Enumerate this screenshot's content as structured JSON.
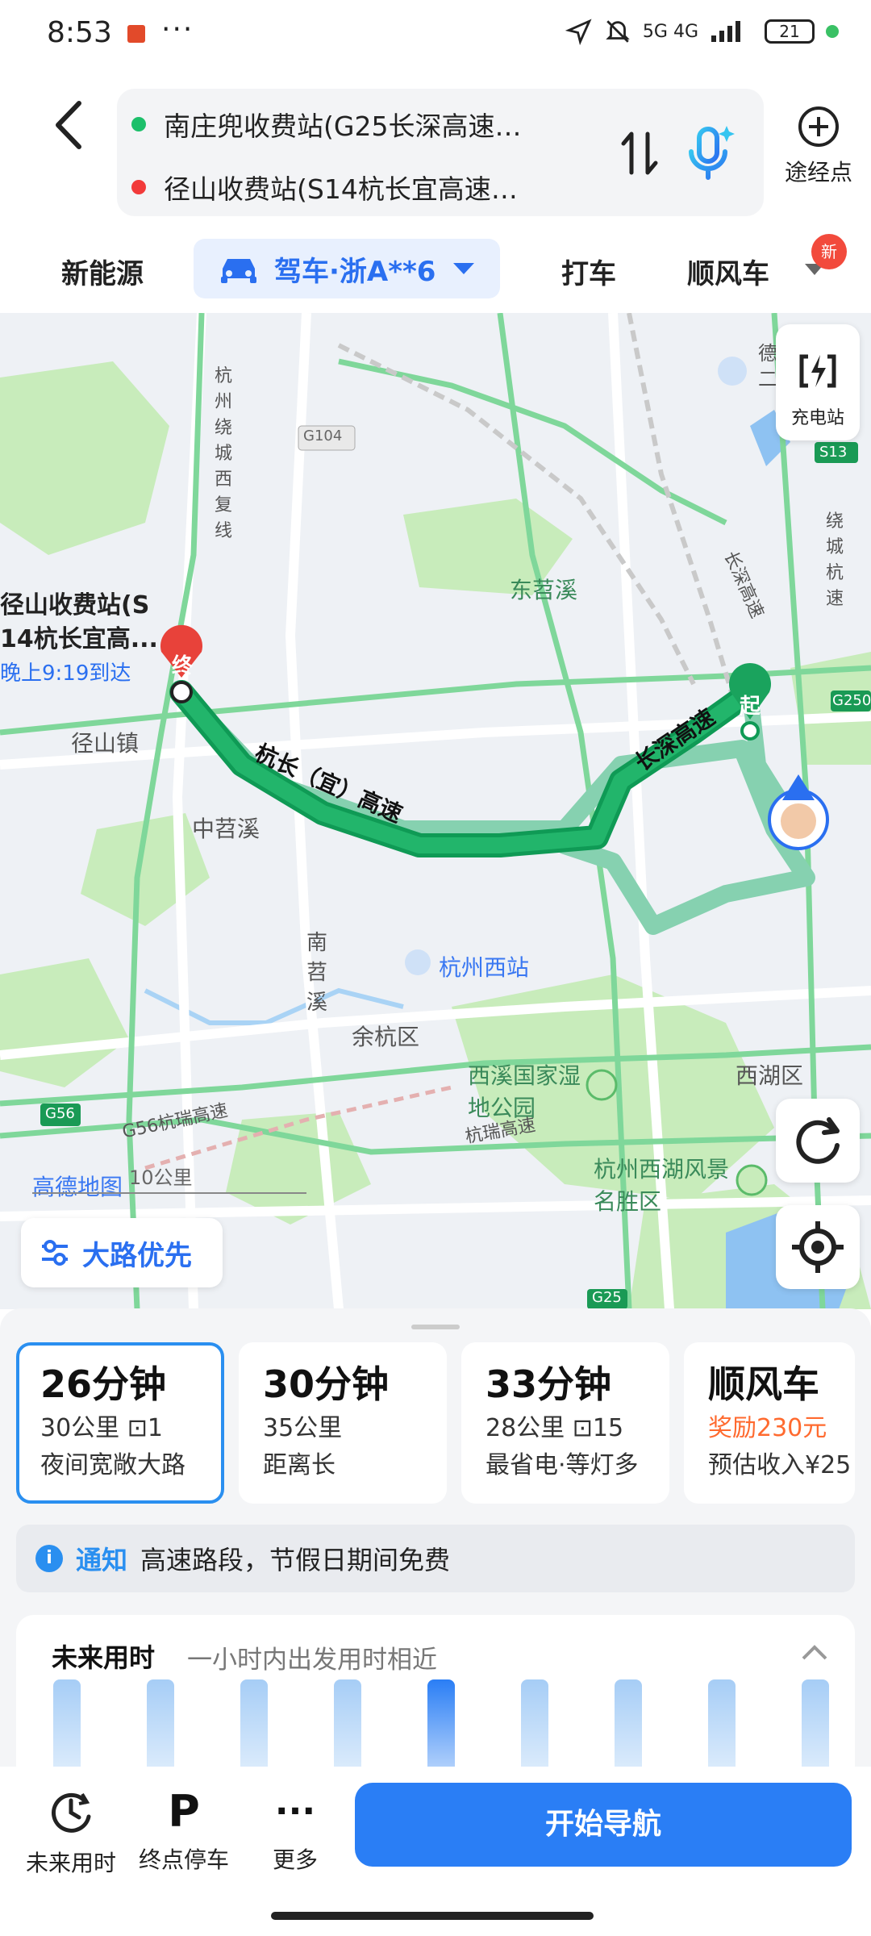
{
  "status_bar": {
    "time": "8:53",
    "dots": "···",
    "network": "5G 4G",
    "battery": "21"
  },
  "header": {
    "origin": "南庄兜收费站(G25长深高速…",
    "destination": "径山收费站(S14杭长宜高速…",
    "waypoint_label": "途经点"
  },
  "tabs": {
    "new_energy": "新能源",
    "drive": "驾车·浙A**6",
    "taxi": "打车",
    "carpool": "顺风车",
    "new_badge": "新"
  },
  "map": {
    "charge_label": "充电站",
    "dest_name_1": "径山收费站(S",
    "dest_name_2": "14杭长宜高...",
    "arrive_time": "晚上9:19到达",
    "start_marker": "起",
    "end_marker": "终",
    "road_pref": "大路优先",
    "amap_logo": "高德地图",
    "scale": "10公里",
    "labels": {
      "jingshan_town": "径山镇",
      "zhongtiaoxi": "中苕溪",
      "nantiaoxi": "南苕溪",
      "dongtiaoxi": "东苕溪",
      "hangzhou_west": "杭州西站",
      "yuhang": "余杭区",
      "xixi": "西溪国家湿地公园",
      "xihu_district": "西湖区",
      "west_lake": "杭州西湖风景名胜区",
      "hangchang": "杭长（宜）高速",
      "changshen": "长深高速",
      "ring_west": "杭州绕城西复线",
      "changshen_side": "长深高速",
      "ring_side": "绕城杭速",
      "g56": "G56",
      "g56_road": "G56杭瑞高速",
      "hangrui": "杭瑞高速",
      "g104": "G104",
      "s13": "S13",
      "g250": "G250",
      "g25": "G25",
      "de": "德",
      "er": "二"
    }
  },
  "routes": [
    {
      "time": "26分钟",
      "dist": "30公里",
      "lights": "1",
      "desc": "夜间宽敞大路",
      "selected": true
    },
    {
      "time": "30分钟",
      "dist": "35公里",
      "lights": "",
      "desc": "距离长",
      "selected": false
    },
    {
      "time": "33分钟",
      "dist": "28公里",
      "lights": "15",
      "desc": "最省电·等灯多",
      "selected": false
    }
  ],
  "carpool_card": {
    "title": "顺风车",
    "reward": "奖励230元",
    "income": "预估收入¥25"
  },
  "notice": {
    "tag": "通知",
    "text": "高速路段，节假日期间免费"
  },
  "future": {
    "title": "未来用时",
    "subtitle": "一小时内出发用时相近",
    "bars": [
      0.55,
      0.55,
      0.55,
      0.55,
      0.55,
      0.55,
      0.55,
      0.55,
      0.55
    ],
    "highlight_index": 4
  },
  "bottom_nav": {
    "future_time": "未来用时",
    "parking": "终点停车",
    "parking_glyph": "P",
    "more": "更多",
    "more_glyph": "···",
    "start_nav": "开始导航"
  }
}
